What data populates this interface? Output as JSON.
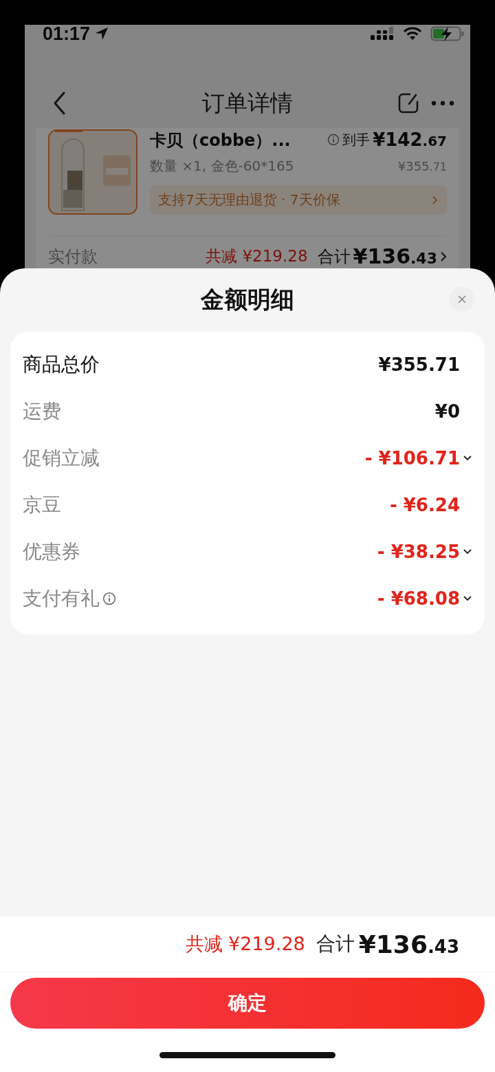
{
  "status_bar": {
    "time": "01:17"
  },
  "nav": {
    "title": "订单详情"
  },
  "product": {
    "title": "卡贝（cobbe）...",
    "specs": "数量 ×1, 金色-60*165",
    "price_label": "到手",
    "price": "¥142.67",
    "original_price": "¥355.71",
    "service": "支持7天无理由退货 · 7天价保"
  },
  "paid": {
    "label": "实付款",
    "discount": "共减 ¥219.28",
    "total_label": "合计",
    "total": "¥136.43"
  },
  "sheet": {
    "title": "金额明细",
    "rows": [
      {
        "label": "商品总价",
        "value": "¥355.71",
        "kind": "total",
        "expandable": false,
        "info": false
      },
      {
        "label": "运费",
        "value": "¥0",
        "kind": "plain",
        "expandable": false,
        "info": false
      },
      {
        "label": "促销立减",
        "value": "- ¥106.71",
        "kind": "discount",
        "expandable": true,
        "info": false
      },
      {
        "label": "京豆",
        "value": "- ¥6.24",
        "kind": "discount",
        "expandable": false,
        "info": false
      },
      {
        "label": "优惠券",
        "value": "- ¥38.25",
        "kind": "discount",
        "expandable": true,
        "info": false
      },
      {
        "label": "支付有礼",
        "value": "- ¥68.08",
        "kind": "discount",
        "expandable": true,
        "info": true
      }
    ],
    "footer": {
      "discount": "共减 ¥219.28",
      "total_label": "合计",
      "total": "¥136.43"
    },
    "confirm_button": "确定"
  }
}
